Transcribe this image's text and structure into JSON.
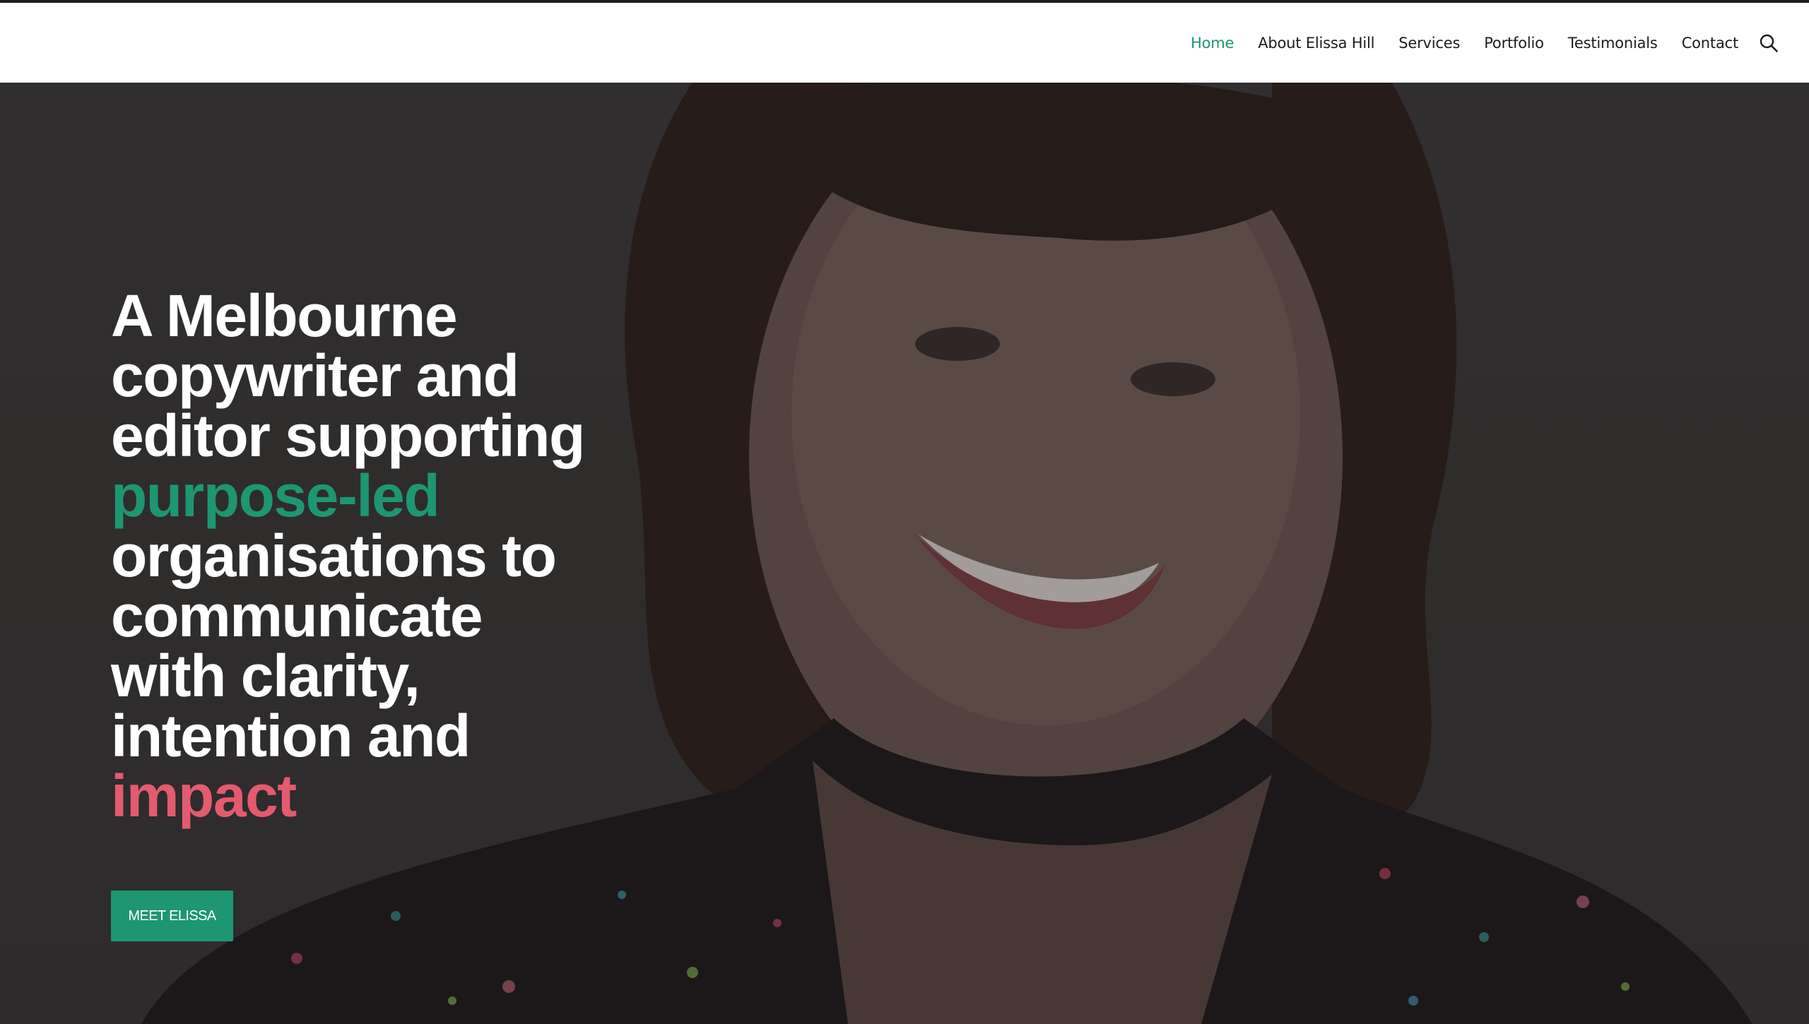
{
  "nav": {
    "items": [
      {
        "label": "Home",
        "active": true
      },
      {
        "label": "About Elissa Hill",
        "active": false
      },
      {
        "label": "Services",
        "active": false
      },
      {
        "label": "Portfolio",
        "active": false
      },
      {
        "label": "Testimonials",
        "active": false
      },
      {
        "label": "Contact",
        "active": false
      }
    ],
    "search_icon": "search-icon"
  },
  "hero": {
    "headline": {
      "line1": "A Melbourne",
      "line2": "copywriter and",
      "line3": "editor supporting",
      "highlight_green": "purpose-led",
      "line5": "organisations to",
      "line6": "communicate",
      "line7": "with clarity,",
      "line8": "intention and",
      "highlight_pink": "impact"
    },
    "cta_label": "MEET ELISSA",
    "image": "portrait-photo"
  },
  "colors": {
    "accent_green": "#1e9672",
    "accent_pink": "#e35b6f",
    "header_bg": "#ffffff",
    "hero_overlay": "#3a3838"
  }
}
